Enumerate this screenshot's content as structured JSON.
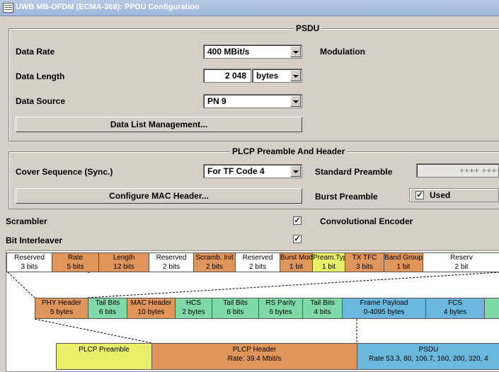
{
  "window": {
    "title": "UWB MB-OFDM (ECMA-368): PPDU Configuration"
  },
  "psdu": {
    "group_title": "PSDU",
    "data_rate": {
      "label": "Data Rate",
      "value": "400 MBit/s"
    },
    "modulation_label": "Modulation",
    "data_length": {
      "label": "Data Length",
      "value": "2 048",
      "unit": "bytes"
    },
    "data_source": {
      "label": "Data Source",
      "value": "PN 9"
    },
    "data_list_button": "Data List Management..."
  },
  "plcp": {
    "group_title": "PLCP Preamble And Header",
    "cover_sequence": {
      "label": "Cover Sequence (Sync.)",
      "value": "For TF Code 4"
    },
    "standard_preamble_label": "Standard Preamble",
    "standard_preamble_value": "++++ ++++",
    "configure_mac_button": "Configure MAC Header...",
    "burst_preamble_label": "Burst Preamble",
    "burst_preamble_check": "Used"
  },
  "scrambler": {
    "label": "Scrambler",
    "checked": true
  },
  "bit_interleaver": {
    "label": "Bit Interleaver",
    "checked": true
  },
  "convolutional_encoder_label": "Convolutional Encoder",
  "check_mark": "✓",
  "diagram": {
    "row1": [
      {
        "name": "Reserved",
        "size": "3 bits",
        "color": "#ffffff"
      },
      {
        "name": "Rate",
        "size": "5 bits",
        "color": "#e0955a"
      },
      {
        "name": "Length",
        "size": "12 bits",
        "color": "#e0955a"
      },
      {
        "name": "Reserved",
        "size": "2 bits",
        "color": "#ffffff"
      },
      {
        "name": "Scramb. Init",
        "size": "2 bits",
        "color": "#e0955a"
      },
      {
        "name": "Reserved",
        "size": "2 bits",
        "color": "#ffffff"
      },
      {
        "name": "Burst Mode",
        "size": "1 bit",
        "color": "#e0955a"
      },
      {
        "name": "Pream.Type",
        "size": "1 bit",
        "color": "#e8f06a"
      },
      {
        "name": "TX TFC",
        "size": "3 bits",
        "color": "#e0955a"
      },
      {
        "name": "Band Group",
        "size": "1 bit",
        "color": "#e0955a"
      },
      {
        "name": "Reserv",
        "size": "2 bit",
        "color": "#ffffff"
      }
    ],
    "row2": [
      {
        "name": "PHY Header",
        "size": "5 bytes",
        "color": "#e0955a"
      },
      {
        "name": "Tail Bits",
        "size": "6 bits",
        "color": "#7fd9a8"
      },
      {
        "name": "MAC Header",
        "size": "10 bytes",
        "color": "#e0955a"
      },
      {
        "name": "HCS",
        "size": "2 bytes",
        "color": "#7fd9a8"
      },
      {
        "name": "Tail Bits",
        "size": "6 bits",
        "color": "#7fd9a8"
      },
      {
        "name": "RS Parity",
        "size": "6 bytes",
        "color": "#7fd9a8"
      },
      {
        "name": "Tail Bits",
        "size": "4 bits",
        "color": "#7fd9a8"
      },
      {
        "name": "Frame Payload",
        "size": "0-4095 bytes",
        "color": "#6ab8dd"
      },
      {
        "name": "FCS",
        "size": "4 bytes",
        "color": "#6ab8dd"
      },
      {
        "name": "",
        "size": "",
        "color": "#7fd9a8"
      }
    ],
    "row3": [
      {
        "name": "PLCP Preamble",
        "size": "",
        "color": "#e8f06a"
      },
      {
        "name": "PLCP Header",
        "size": "Rate: 39.4 Mbit/s",
        "color": "#e0955a"
      },
      {
        "name": "PSDU",
        "size": "Rate 53.3, 80, 106.7, 160, 200, 320, 4",
        "color": "#6ab8dd"
      }
    ]
  }
}
